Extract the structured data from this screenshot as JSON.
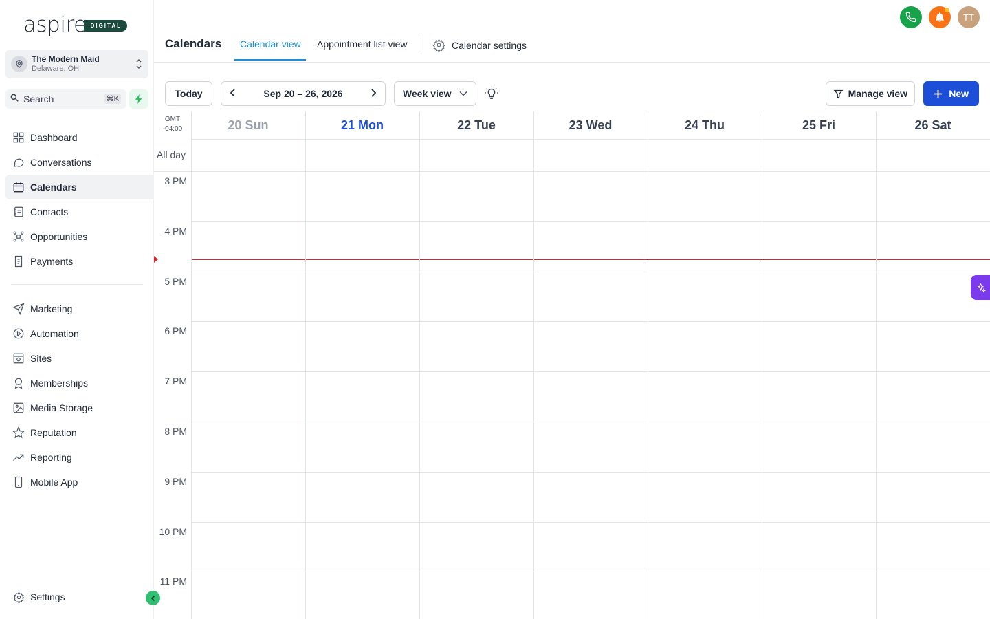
{
  "brand": {
    "word": "aspire",
    "badge": "DIGITAL"
  },
  "account": {
    "name": "The Modern Maid",
    "location": "Delaware, OH"
  },
  "search": {
    "label": "Search",
    "shortcut": "⌘K"
  },
  "sidebar": {
    "items": [
      {
        "label": "Dashboard",
        "icon": "dashboard-icon"
      },
      {
        "label": "Conversations",
        "icon": "chat-icon"
      },
      {
        "label": "Calendars",
        "icon": "calendar-icon",
        "active": true
      },
      {
        "label": "Contacts",
        "icon": "contacts-icon"
      },
      {
        "label": "Opportunities",
        "icon": "opportunities-icon"
      },
      {
        "label": "Payments",
        "icon": "payments-icon"
      },
      {
        "label": "Marketing",
        "icon": "send-icon"
      },
      {
        "label": "Automation",
        "icon": "automation-icon"
      },
      {
        "label": "Sites",
        "icon": "sites-icon"
      },
      {
        "label": "Memberships",
        "icon": "award-icon"
      },
      {
        "label": "Media Storage",
        "icon": "image-icon"
      },
      {
        "label": "Reputation",
        "icon": "star-icon"
      },
      {
        "label": "Reporting",
        "icon": "trend-icon"
      },
      {
        "label": "Mobile App",
        "icon": "mobile-icon"
      }
    ],
    "settings": "Settings"
  },
  "header": {
    "title": "Calendars",
    "tabs": [
      "Calendar view",
      "Appointment list view"
    ],
    "settings_tab": "Calendar settings",
    "avatar_initials": "TT"
  },
  "toolbar": {
    "today": "Today",
    "range": "Sep 20 – 26, 2026",
    "view": "Week view",
    "manage": "Manage view",
    "new": "New"
  },
  "calendar": {
    "timezone_line1": "GMT",
    "timezone_line2": "-04:00",
    "all_day": "All day",
    "days": [
      "20 Sun",
      "21 Mon",
      "22 Tue",
      "23 Wed",
      "24 Thu",
      "25 Fri",
      "26 Sat"
    ],
    "today_index": 1,
    "hours": [
      "3 PM",
      "4 PM",
      "5 PM",
      "6 PM",
      "7 PM",
      "8 PM",
      "9 PM",
      "10 PM",
      "11 PM"
    ]
  },
  "colors": {
    "accent": "#1d4ed8",
    "tab_active": "#1f8fd6",
    "now_line": "#dc2626"
  }
}
